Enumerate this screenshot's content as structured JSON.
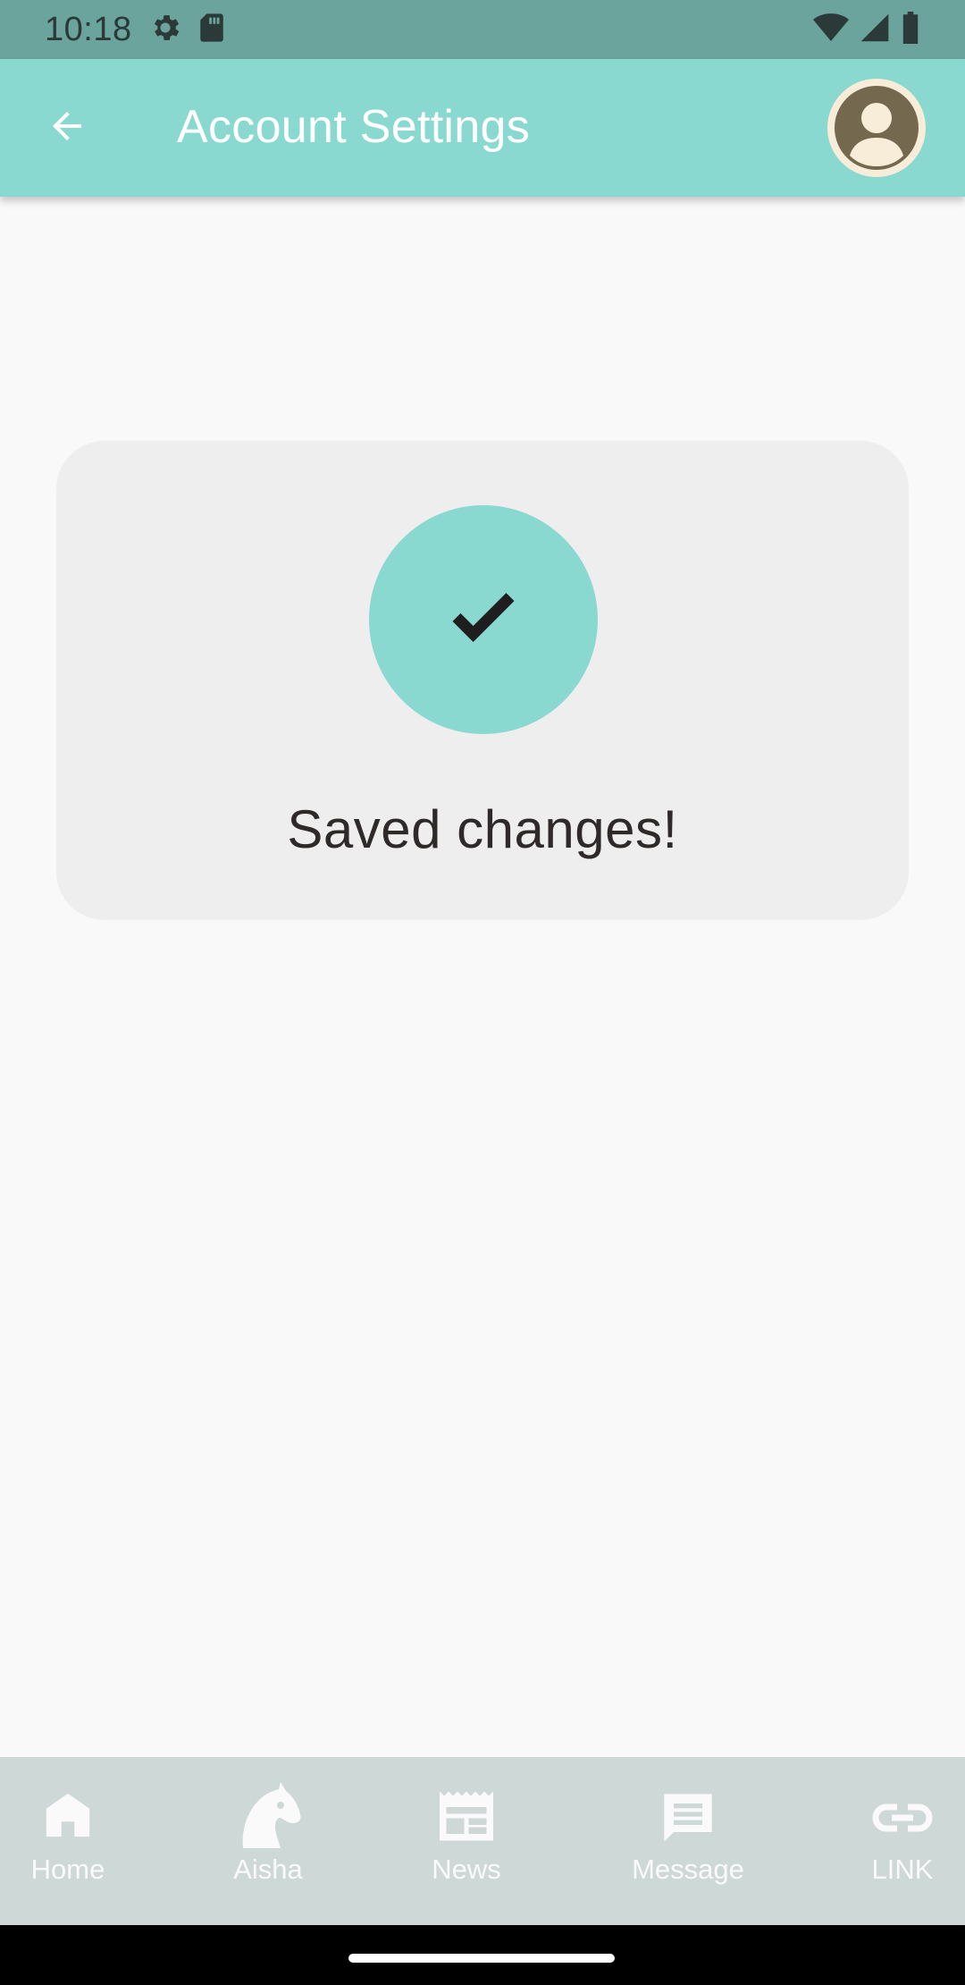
{
  "status_bar": {
    "time": "10:18",
    "left_icons": [
      "settings-gear-icon",
      "sd-card-icon"
    ],
    "right_icons": [
      "wifi-icon",
      "cell-signal-icon",
      "battery-icon"
    ]
  },
  "app_bar": {
    "back_icon": "arrow-back-icon",
    "title": "Account Settings",
    "avatar_icon": "account-avatar-icon"
  },
  "card": {
    "icon": "checkmark-icon",
    "message": "Saved changes!"
  },
  "bottom_nav": {
    "items": [
      {
        "label": "Home",
        "icon": "home-icon"
      },
      {
        "label": "Aisha",
        "icon": "horse-head-icon"
      },
      {
        "label": "News",
        "icon": "newspaper-icon"
      },
      {
        "label": "Message",
        "icon": "chat-bubble-icon"
      },
      {
        "label": "LINK",
        "icon": "link-icon"
      }
    ]
  },
  "colors": {
    "status_bar": "#6aa49c",
    "app_bar": "#8ad9d0",
    "accent": "#8ad9d0",
    "card": "#eeeeee",
    "bottom_nav": "#cdd8d7",
    "background": "#f9f9f9"
  }
}
